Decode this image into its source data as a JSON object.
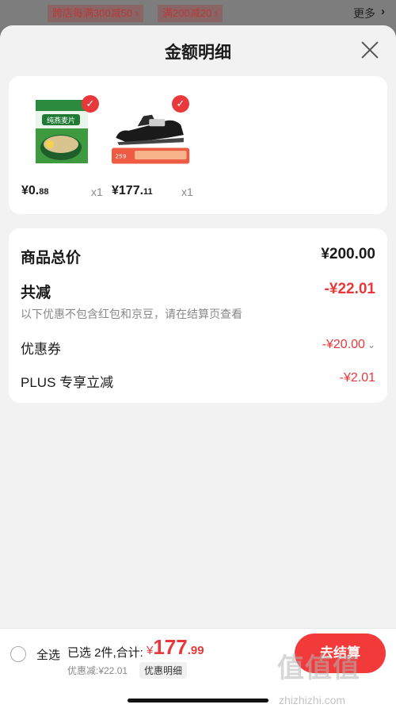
{
  "top_bar": {
    "promo1": "跨店每满300减50 ›",
    "promo2": "满200减20 ›",
    "more": "更多",
    "more_arrow": "›"
  },
  "sheet": {
    "title": "金额明细"
  },
  "products": [
    {
      "image_label": "纯燕麦片",
      "price_int": "¥0.",
      "price_dec": "88",
      "qty": "x1"
    },
    {
      "image_label": "sandal",
      "price_int": "¥177.",
      "price_dec": "11",
      "qty": "x1"
    }
  ],
  "summary": {
    "total_label": "商品总价",
    "total_value": "¥200.00",
    "reduce_label": "共减",
    "reduce_value": "-¥22.01",
    "note": "以下优惠不包含红包和京豆，请在结算页查看",
    "coupon_label": "优惠券",
    "coupon_value": "-¥20.00",
    "plus_label": "PLUS 专享立减",
    "plus_value": "-¥2.01"
  },
  "bottom": {
    "select_all": "全选",
    "selected_text": "已选 2件,合计:",
    "yen": "¥",
    "total_int": "177",
    "total_dec": ".99",
    "discount_text": "优惠减:¥22.01",
    "detail_link": "优惠明细",
    "checkout": "去结算",
    "watermark": "值值值",
    "watermark_sub": "zhizhizhi.com"
  },
  "colors": {
    "accent": "#e8383b",
    "button": "#f23a3a",
    "sheet_bg": "#f2f2f2"
  }
}
